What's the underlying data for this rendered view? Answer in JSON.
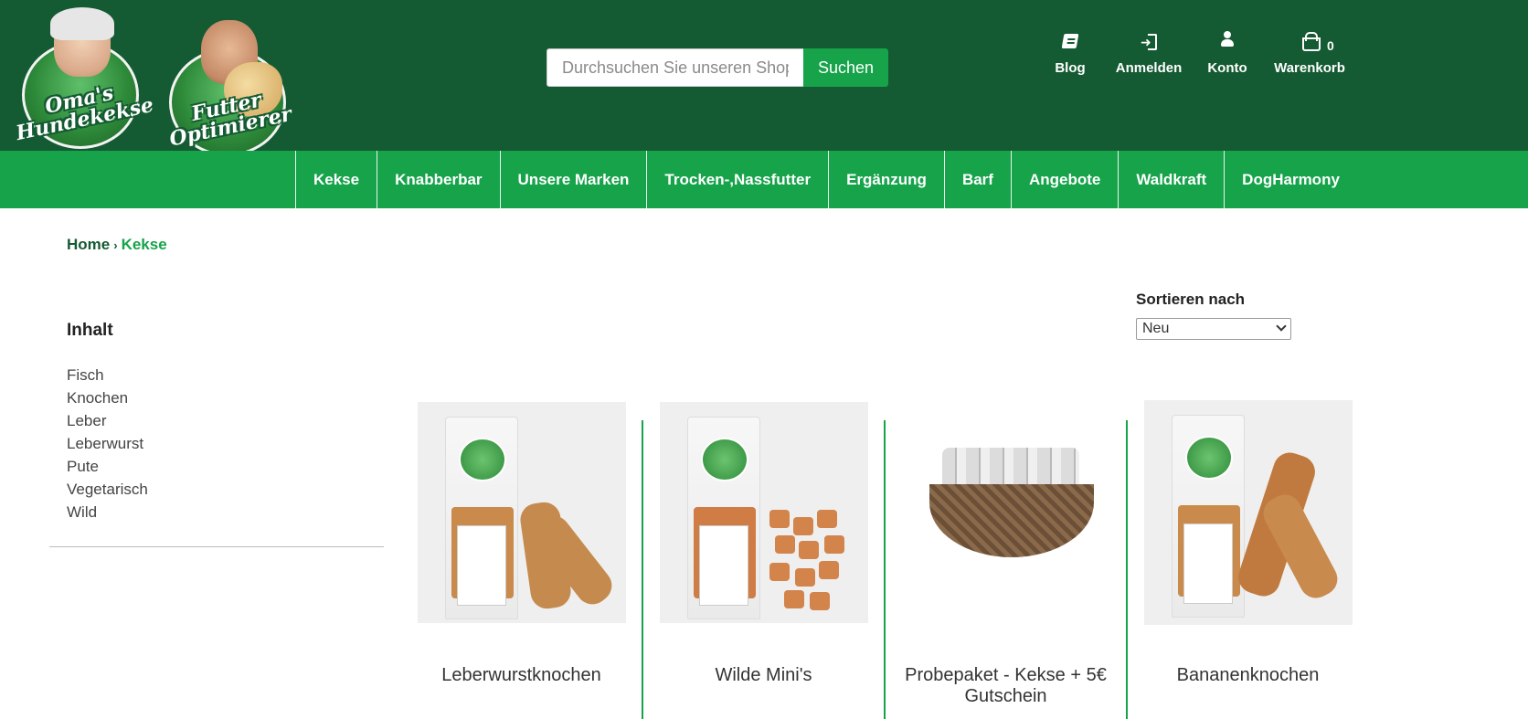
{
  "brand": {
    "logo1_text": "Oma's Hundekekse",
    "logo2_text": "Futter Optimierer"
  },
  "search": {
    "placeholder": "Durchsuchen Sie unseren Shop",
    "button_label": "Suchen"
  },
  "user_nav": {
    "blog": "Blog",
    "login": "Anmelden",
    "account": "Konto",
    "cart": "Warenkorb",
    "cart_count": "0"
  },
  "main_nav": [
    "Kekse",
    "Knabberbar",
    "Unsere Marken",
    "Trocken-,Nassfutter",
    "Ergänzung",
    "Barf",
    "Angebote",
    "Waldkraft",
    "DogHarmony"
  ],
  "breadcrumb": {
    "home": "Home",
    "separator": "›",
    "current": "Kekse"
  },
  "sidebar": {
    "title": "Inhalt",
    "items": [
      "Fisch",
      "Knochen",
      "Leber",
      "Leberwurst",
      "Pute",
      "Vegetarisch",
      "Wild"
    ]
  },
  "sort": {
    "label": "Sortieren nach",
    "selected": "Neu"
  },
  "products": [
    {
      "name": "Leberwurstknochen"
    },
    {
      "name": "Wilde Mini's"
    },
    {
      "name": "Probepaket - Kekse + 5€ Gutschein"
    },
    {
      "name": "Bananenknochen"
    }
  ],
  "colors": {
    "header_dark": "#145a32",
    "accent_green": "#16a34a"
  }
}
